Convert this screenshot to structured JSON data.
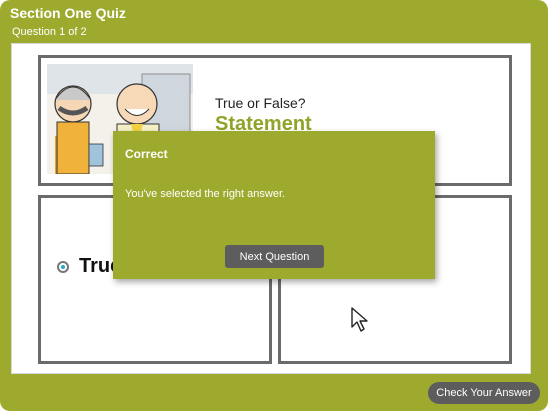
{
  "quiz": {
    "title": "Section One Quiz",
    "progress": "Question 1 of 2"
  },
  "question": {
    "label": "True or False?",
    "statement": "Statement",
    "options": [
      {
        "label": "True",
        "selected": true
      }
    ]
  },
  "modal": {
    "title": "Correct",
    "message": "You've selected the right answer.",
    "next_button": "Next Question"
  },
  "footer": {
    "check_button": "Check Your Answer"
  },
  "colors": {
    "accent": "#9daa2e",
    "button": "#5d5d5d",
    "statement": "#8fa428",
    "radio_selected": "#2aa9c8"
  },
  "icons": {
    "cursor": "mouse-pointer-icon",
    "radio": "radio-selected-icon"
  }
}
